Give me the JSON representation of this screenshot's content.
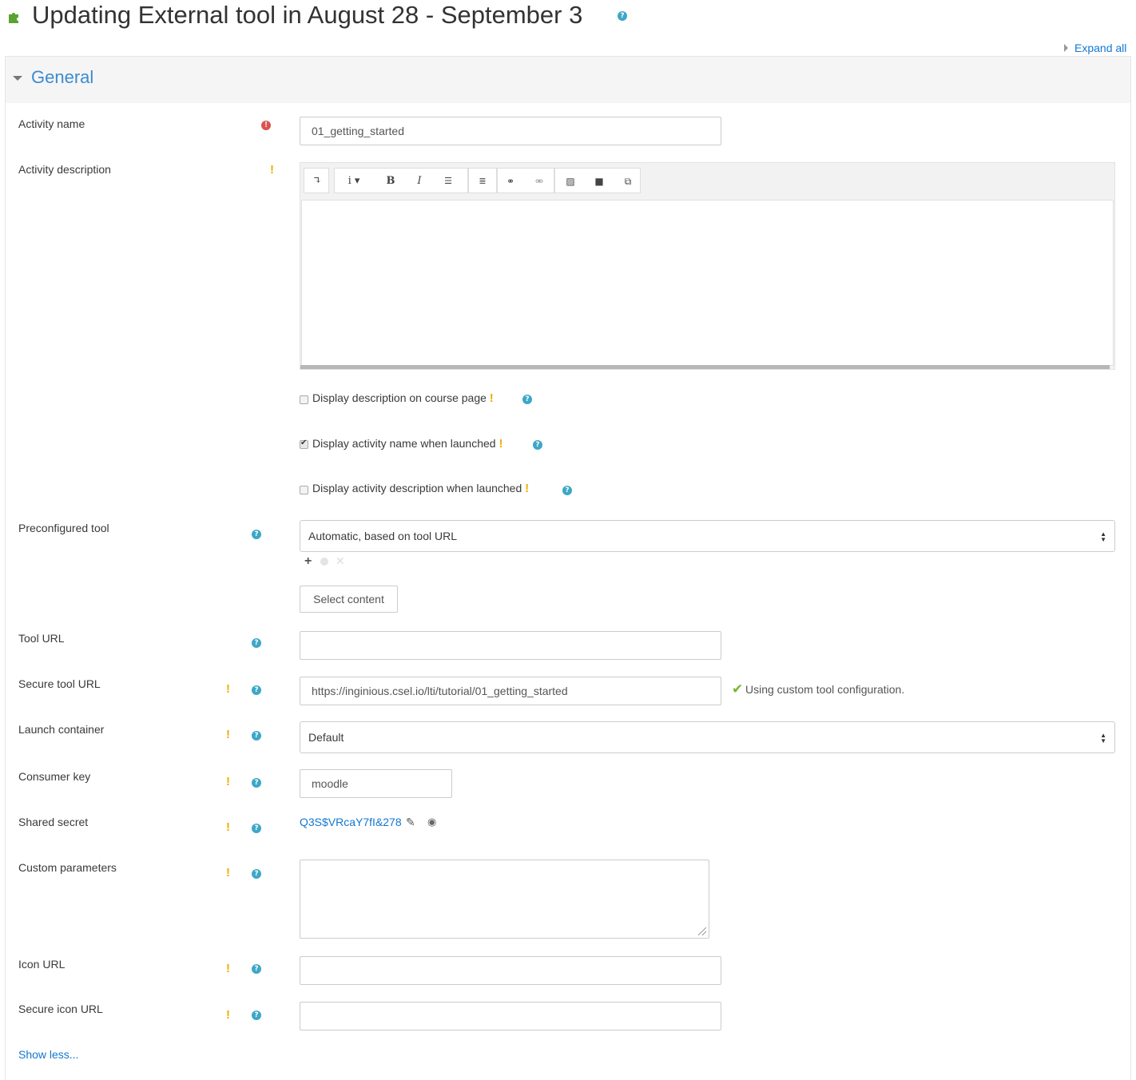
{
  "header": {
    "title": "Updating External tool in August 28 - September 3",
    "help_icon": "question-circle-icon",
    "page_icon": "puzzle-piece-icon",
    "expand_all": "Expand all"
  },
  "section": {
    "legend": "General"
  },
  "fields": {
    "activity_name": {
      "label": "Activity name",
      "value": "01_getting_started",
      "required": true
    },
    "activity_description": {
      "label": "Activity description"
    },
    "display_description_on_course_page": {
      "label": "Display description on course page",
      "checked": false
    },
    "display_activity_name_when_launched": {
      "label": "Display activity name when launched",
      "checked": true
    },
    "display_activity_description_when_launched": {
      "label": "Display activity description when launched",
      "checked": false
    },
    "preconfigured_tool": {
      "label": "Preconfigured tool",
      "value": "Automatic, based on tool URL"
    },
    "select_content": {
      "label": "Select content"
    },
    "tool_url": {
      "label": "Tool URL",
      "value": ""
    },
    "secure_tool_url": {
      "label": "Secure tool URL",
      "value": "https://inginious.csel.io/lti/tutorial/01_getting_started",
      "status": "Using custom tool configuration."
    },
    "launch_container": {
      "label": "Launch container",
      "value": "Default"
    },
    "consumer_key": {
      "label": "Consumer key",
      "value": "moodle"
    },
    "shared_secret": {
      "label": "Shared secret",
      "value": "Q3S$VRcaY7fI&278"
    },
    "custom_parameters": {
      "label": "Custom parameters",
      "value": ""
    },
    "icon_url": {
      "label": "Icon URL",
      "value": ""
    },
    "secure_icon_url": {
      "label": "Secure icon URL",
      "value": ""
    }
  },
  "advanced_mark": "!",
  "show_less": "Show less...",
  "colors": {
    "link": "#1177d1",
    "help": "#3da7c7",
    "required": "#d9534f",
    "advanced": "#f0ad00",
    "success": "#7ab32e"
  }
}
